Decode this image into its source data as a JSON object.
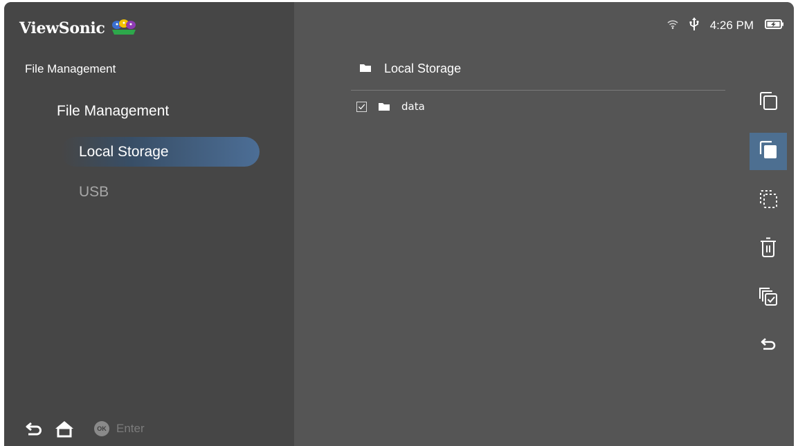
{
  "brand": {
    "logo_text": "ViewSonic"
  },
  "status_bar": {
    "time": "4:26 PM",
    "icons": [
      "wifi-icon",
      "usb-icon",
      "battery-icon"
    ]
  },
  "sidebar": {
    "title": "File Management",
    "group_label": "File Management",
    "items": [
      {
        "label": "Local Storage",
        "selected": true
      },
      {
        "label": "USB",
        "selected": false
      }
    ]
  },
  "bottom_bar": {
    "icons": [
      "back-icon",
      "home-icon"
    ],
    "ok_badge": "OK",
    "enter_label": "Enter"
  },
  "content": {
    "path_label": "Local Storage",
    "files": [
      {
        "name": "data",
        "checked": true,
        "type": "folder"
      }
    ]
  },
  "actions": [
    {
      "name": "copy",
      "icon": "copy-icon",
      "selected": false
    },
    {
      "name": "paste",
      "icon": "paste-icon",
      "selected": true
    },
    {
      "name": "cut",
      "icon": "cut-icon",
      "selected": false
    },
    {
      "name": "delete",
      "icon": "delete-icon",
      "selected": false
    },
    {
      "name": "select-all",
      "icon": "select-all-icon",
      "selected": false
    },
    {
      "name": "back",
      "icon": "return-icon",
      "selected": false
    }
  ],
  "colors": {
    "sidebar_bg": "#464646",
    "content_bg": "#555555",
    "accent": "#4d6f91",
    "text": "#ffffff",
    "dim_text": "#a7a7a7"
  }
}
